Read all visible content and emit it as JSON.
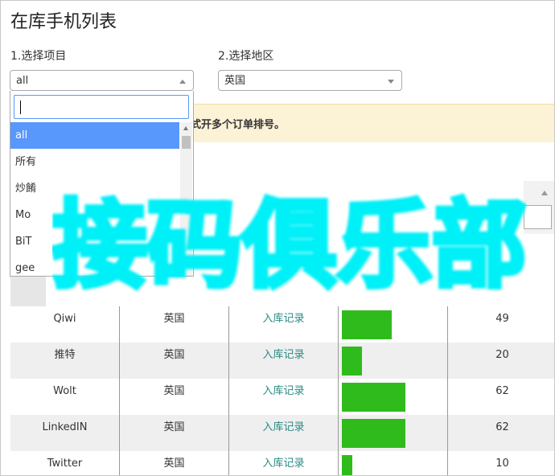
{
  "page": {
    "title": "在库手机列表"
  },
  "filters": {
    "project_label": "1.选择项目",
    "project_value": "all",
    "region_label": "2.选择地区",
    "region_value": "英国"
  },
  "notice": {
    "text": "式开多个订单排号。"
  },
  "dropdown": {
    "search_value": "",
    "options": [
      "all",
      "所有",
      "炒餚",
      "Mo",
      "BiT",
      "gee"
    ]
  },
  "watermark": {
    "text": "接码俱乐部"
  },
  "table": {
    "rows": [
      {
        "name": "Qiwi",
        "region": "英国",
        "link": "入库记录",
        "count": "49",
        "fraction": 0.49
      },
      {
        "name": "推特",
        "region": "英国",
        "link": "入库记录",
        "count": "20",
        "fraction": 0.2
      },
      {
        "name": "Wolt",
        "region": "英国",
        "link": "入库记录",
        "count": "62",
        "fraction": 0.62
      },
      {
        "name": "LinkedIN",
        "region": "英国",
        "link": "入库记录",
        "count": "62",
        "fraction": 0.62
      },
      {
        "name": "Twitter",
        "region": "英国",
        "link": "入库记录",
        "count": "10",
        "fraction": 0.1
      }
    ]
  },
  "colors": {
    "bar": "#2fbb1c",
    "link": "#2a8a82",
    "selected": "#5897fb",
    "watermark": "#00f0f8"
  }
}
